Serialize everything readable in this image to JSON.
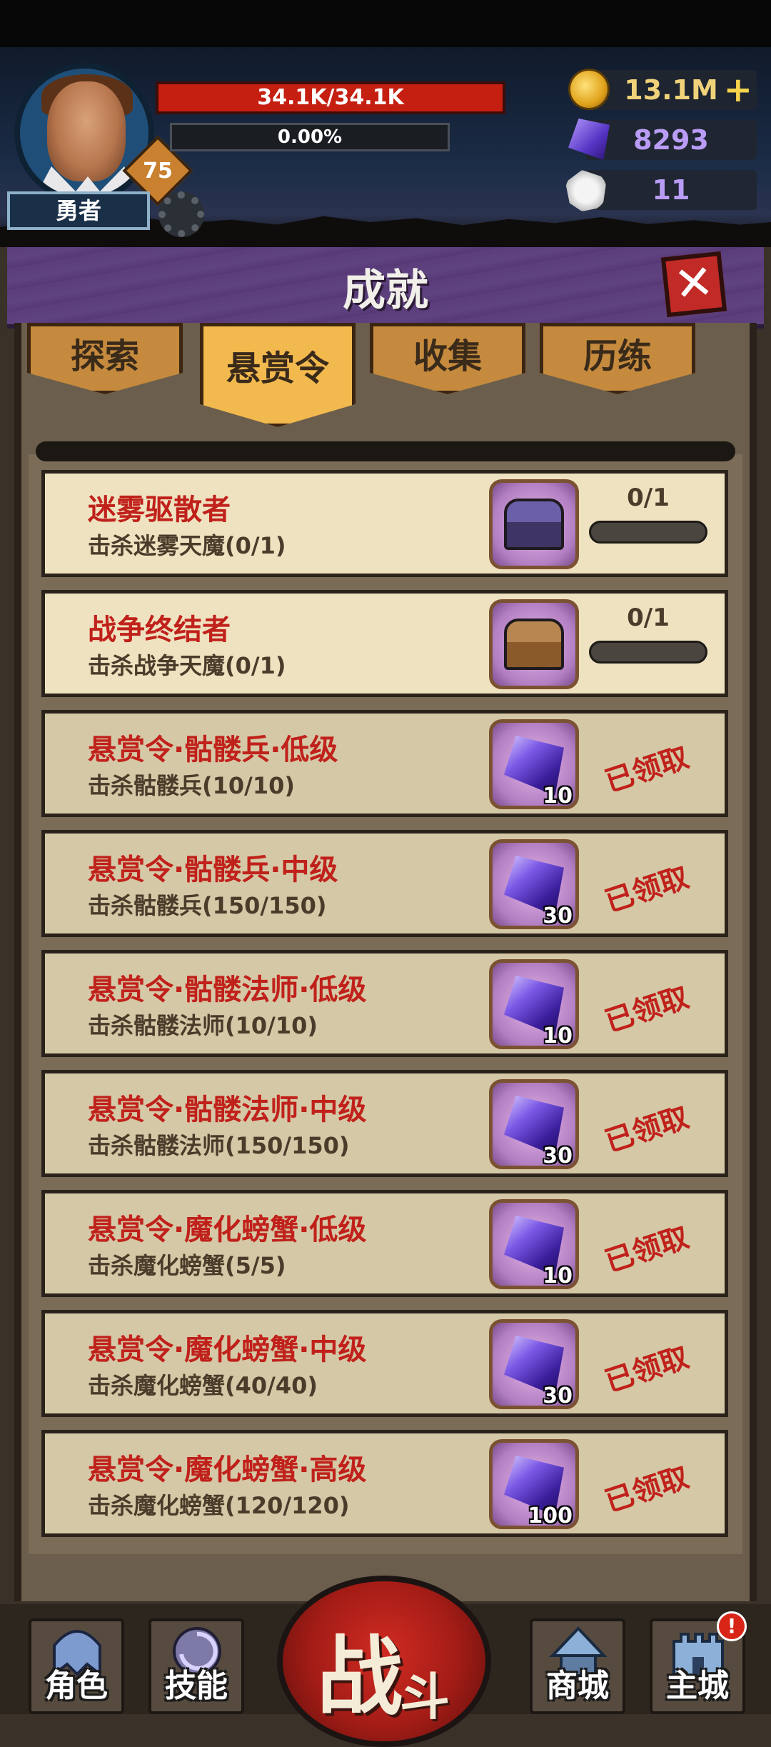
{
  "player": {
    "name": "勇者",
    "level": "75",
    "hp_text": "34.1K/34.1K",
    "exp_text": "0.00%",
    "exp_fraction": 0
  },
  "resources": {
    "gold": "13.1M",
    "crystal": "8293",
    "ram": "11"
  },
  "panel": {
    "title": "成就",
    "close_symbol": "✕"
  },
  "tabs": [
    {
      "label": "探索",
      "active": false
    },
    {
      "label": "悬赏令",
      "active": true
    },
    {
      "label": "收集",
      "active": false
    },
    {
      "label": "历练",
      "active": false
    }
  ],
  "achievements": [
    {
      "title": "迷雾驱散者",
      "desc": "击杀迷雾天魔(0/1)",
      "reward": "chest-purple",
      "progress": "0/1",
      "fraction": 0,
      "claimed": false
    },
    {
      "title": "战争终结者",
      "desc": "击杀战争天魔(0/1)",
      "reward": "chest-brown",
      "progress": "0/1",
      "fraction": 0,
      "claimed": false
    },
    {
      "title": "悬赏令·骷髅兵·低级",
      "desc": "击杀骷髅兵(10/10)",
      "reward": "crystal",
      "qty": "10",
      "claimed": true,
      "status": "已领取"
    },
    {
      "title": "悬赏令·骷髅兵·中级",
      "desc": "击杀骷髅兵(150/150)",
      "reward": "crystal",
      "qty": "30",
      "claimed": true,
      "status": "已领取"
    },
    {
      "title": "悬赏令·骷髅法师·低级",
      "desc": "击杀骷髅法师(10/10)",
      "reward": "crystal",
      "qty": "10",
      "claimed": true,
      "status": "已领取"
    },
    {
      "title": "悬赏令·骷髅法师·中级",
      "desc": "击杀骷髅法师(150/150)",
      "reward": "crystal",
      "qty": "30",
      "claimed": true,
      "status": "已领取"
    },
    {
      "title": "悬赏令·魔化螃蟹·低级",
      "desc": "击杀魔化螃蟹(5/5)",
      "reward": "crystal",
      "qty": "10",
      "claimed": true,
      "status": "已领取"
    },
    {
      "title": "悬赏令·魔化螃蟹·中级",
      "desc": "击杀魔化螃蟹(40/40)",
      "reward": "crystal",
      "qty": "30",
      "claimed": true,
      "status": "已领取"
    },
    {
      "title": "悬赏令·魔化螃蟹·高级",
      "desc": "击杀魔化螃蟹(120/120)",
      "reward": "crystal",
      "qty": "100",
      "claimed": true,
      "status": "已领取"
    }
  ],
  "nav": {
    "role": "角色",
    "skill": "技能",
    "battle_1": "战",
    "battle_2": "斗",
    "shop": "商城",
    "city": "主城",
    "city_alert": "!"
  }
}
